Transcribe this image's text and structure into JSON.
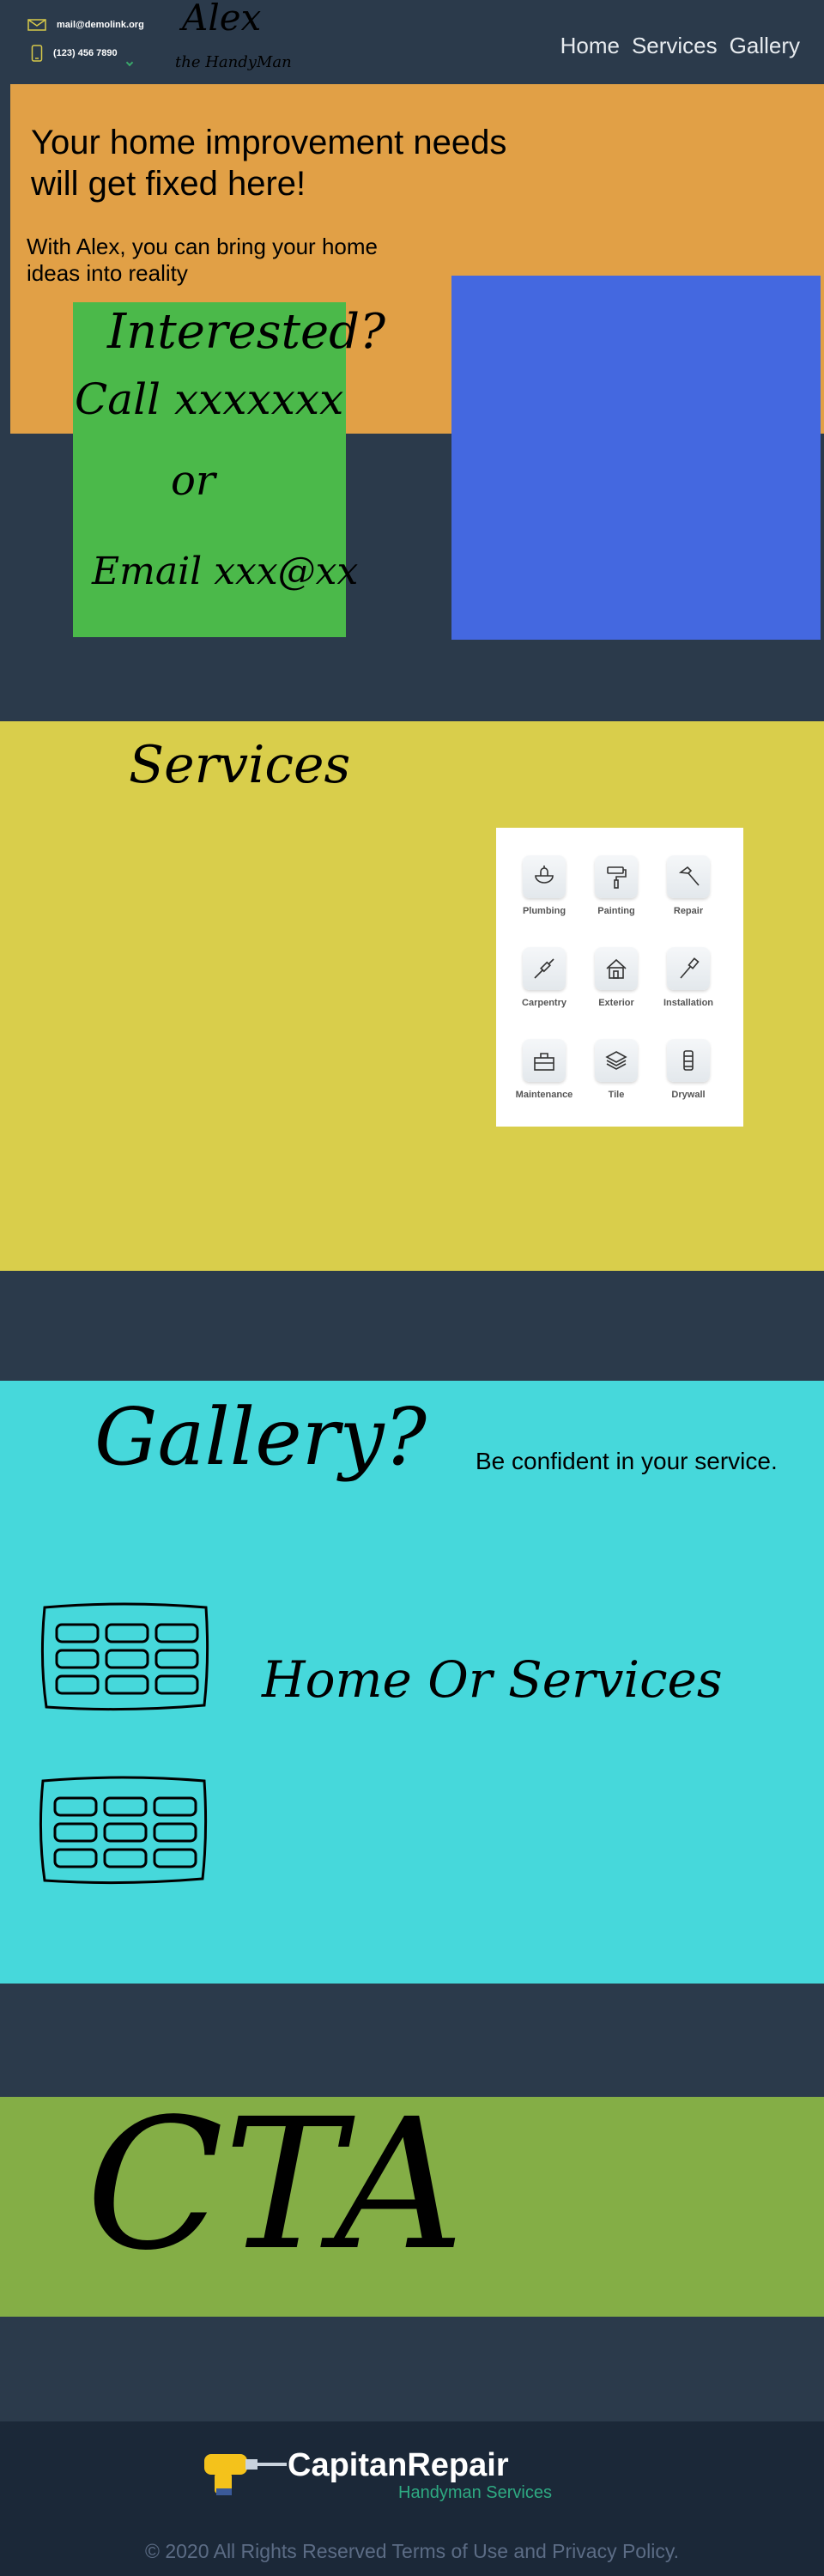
{
  "header": {
    "email": "mail@demolink.org",
    "phone": "(123) 456 7890",
    "logo_name": "Alex",
    "logo_tagline": "the HandyMan",
    "nav": [
      "Home",
      "Services",
      "Gallery"
    ]
  },
  "hero": {
    "title": "Your home improvement needs will get fixed here!",
    "subtitle": "With Alex, you can bring your home ideas into reality",
    "interested": {
      "heading": "Interested?",
      "call": "Call xxxxxxx",
      "or": "or",
      "email": "Email xxx@xx"
    }
  },
  "services": {
    "title": "Services",
    "items": [
      {
        "label": "Plumbing",
        "icon": "plumbing-icon"
      },
      {
        "label": "Painting",
        "icon": "paint-roller-icon"
      },
      {
        "label": "Repair",
        "icon": "hammer-icon"
      },
      {
        "label": "Carpentry",
        "icon": "chisel-icon"
      },
      {
        "label": "Exterior",
        "icon": "house-icon"
      },
      {
        "label": "Installation",
        "icon": "drill-icon"
      },
      {
        "label": "Maintenance",
        "icon": "toolbox-icon"
      },
      {
        "label": "Tile",
        "icon": "tile-stack-icon"
      },
      {
        "label": "Drywall",
        "icon": "drywall-icon"
      }
    ]
  },
  "gallery": {
    "title": "Gallery?",
    "tagline": "Be confident in your service.",
    "caption": "Home Or Services"
  },
  "cta": {
    "title": "CTA"
  },
  "footer": {
    "brand_name": "CapitanRepair",
    "brand_tagline": "Handyman Services",
    "copyright": "© 2020 All Rights Reserved Terms of Use and Privacy Policy."
  },
  "colors": {
    "page_bg": "#2b3a4b",
    "hero_bg": "#e1a046",
    "interested_bg": "#4bb94a",
    "media_placeholder": "#4468e0",
    "services_bg": "#d9ce4b",
    "gallery_bg": "#46d8db",
    "cta_bg": "#84ae46",
    "footer_bg": "#1b2838",
    "footer_accent": "#2eaa82"
  }
}
